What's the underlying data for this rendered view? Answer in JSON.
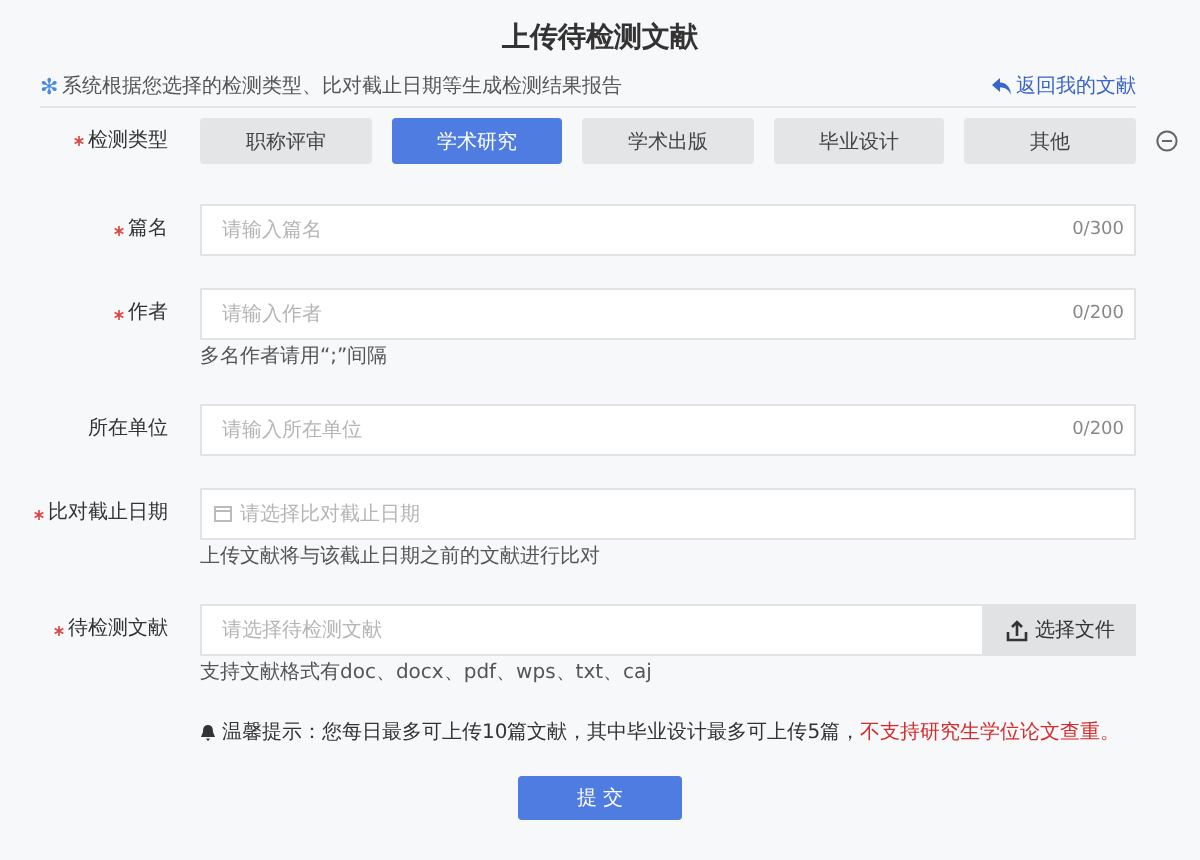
{
  "title": "上传待检测文献",
  "notice": {
    "icon": "✻",
    "text": "系统根据您选择的检测类型、比对截止日期等生成检测结果报告"
  },
  "back_link": "返回我的文献",
  "type_row": {
    "label": "检测类型",
    "required": true,
    "options": [
      {
        "label": "职称评审",
        "selected": false
      },
      {
        "label": "学术研究",
        "selected": true
      },
      {
        "label": "学术出版",
        "selected": false
      },
      {
        "label": "毕业设计",
        "selected": false
      },
      {
        "label": "其他",
        "selected": false
      }
    ]
  },
  "fields": [
    {
      "kind": "text",
      "label": "篇名",
      "required": true,
      "placeholder": "请输入篇名",
      "counter": "0/300"
    },
    {
      "kind": "text",
      "label": "作者",
      "required": true,
      "placeholder": "请输入作者",
      "counter": "0/200",
      "hint": "多名作者请用“;”间隔"
    },
    {
      "kind": "text",
      "label": "所在单位",
      "required": false,
      "placeholder": "请输入所在单位",
      "counter": "0/200"
    },
    {
      "kind": "date",
      "label": "比对截止日期",
      "required": true,
      "placeholder": "请选择比对截止日期",
      "hint": "上传文献将与该截止日期之前的文献进行比对"
    },
    {
      "kind": "file",
      "label": "待检测文献",
      "required": true,
      "placeholder": "请选择待检测文献",
      "button": "选择文件",
      "hint": "支持文献格式有doc、docx、pdf、wps、txt、caj"
    }
  ],
  "tip": {
    "text": "温馨提示：您每日最多可上传10篇文献，其中毕业设计最多可上传5篇，",
    "warning": "不支持研究生学位论文查重。"
  },
  "submit": "提 交"
}
